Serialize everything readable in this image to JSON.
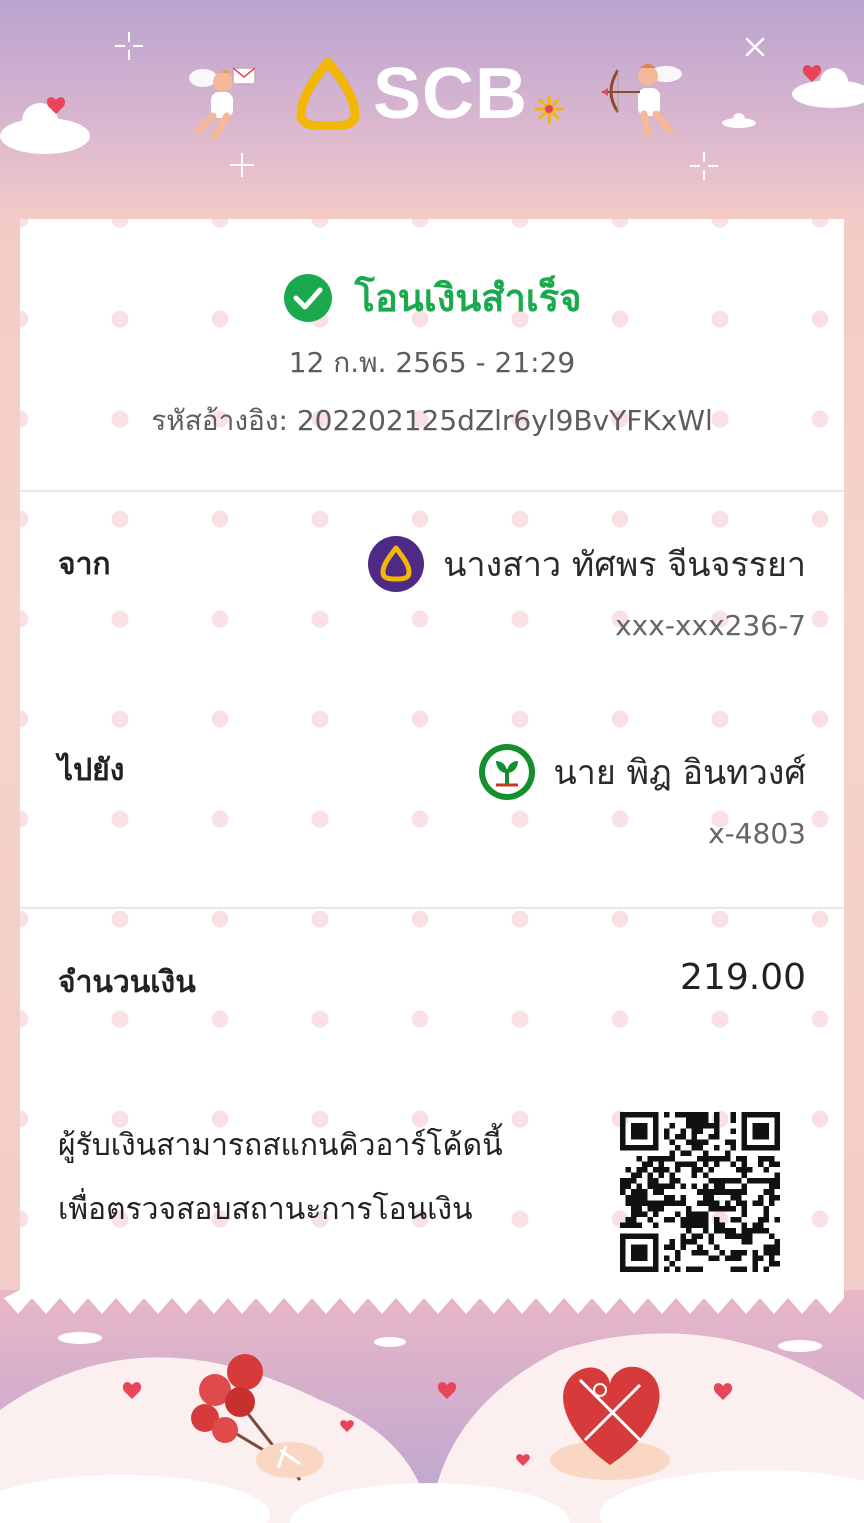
{
  "header": {
    "brand": "SCB",
    "close_icon": "close-icon"
  },
  "receipt": {
    "status": "โอนเงินสำเร็จ",
    "datetime": "12 ก.พ. 2565 - 21:29",
    "reference": "รหัสอ้างอิง: 202202125dZlr6yl9BvYFKxWl",
    "from": {
      "label": "จาก",
      "name": "นางสาว ทัศพร จีนจรรยา",
      "account": "xxx-xxx236-7",
      "bank_icon": "scb-bank-icon",
      "bank_color": "#4e2a84"
    },
    "to": {
      "label": "ไปยัง",
      "name": "นาย พิฎ อินทวงศ์",
      "account": "x-4803",
      "bank_icon": "kbank-icon",
      "bank_color": "#138f2d"
    },
    "amount": {
      "label": "จำนวนเงิน",
      "value": "219.00"
    },
    "qr_note": {
      "line1": "ผู้รับเงินสามารถสแกนคิวอาร์โค้ดนี้",
      "line2": "เพื่อตรวจสอบสถานะการโอนเงิน"
    }
  },
  "colors": {
    "success": "#1aaa4d",
    "brand_gold": "#f2b705"
  }
}
